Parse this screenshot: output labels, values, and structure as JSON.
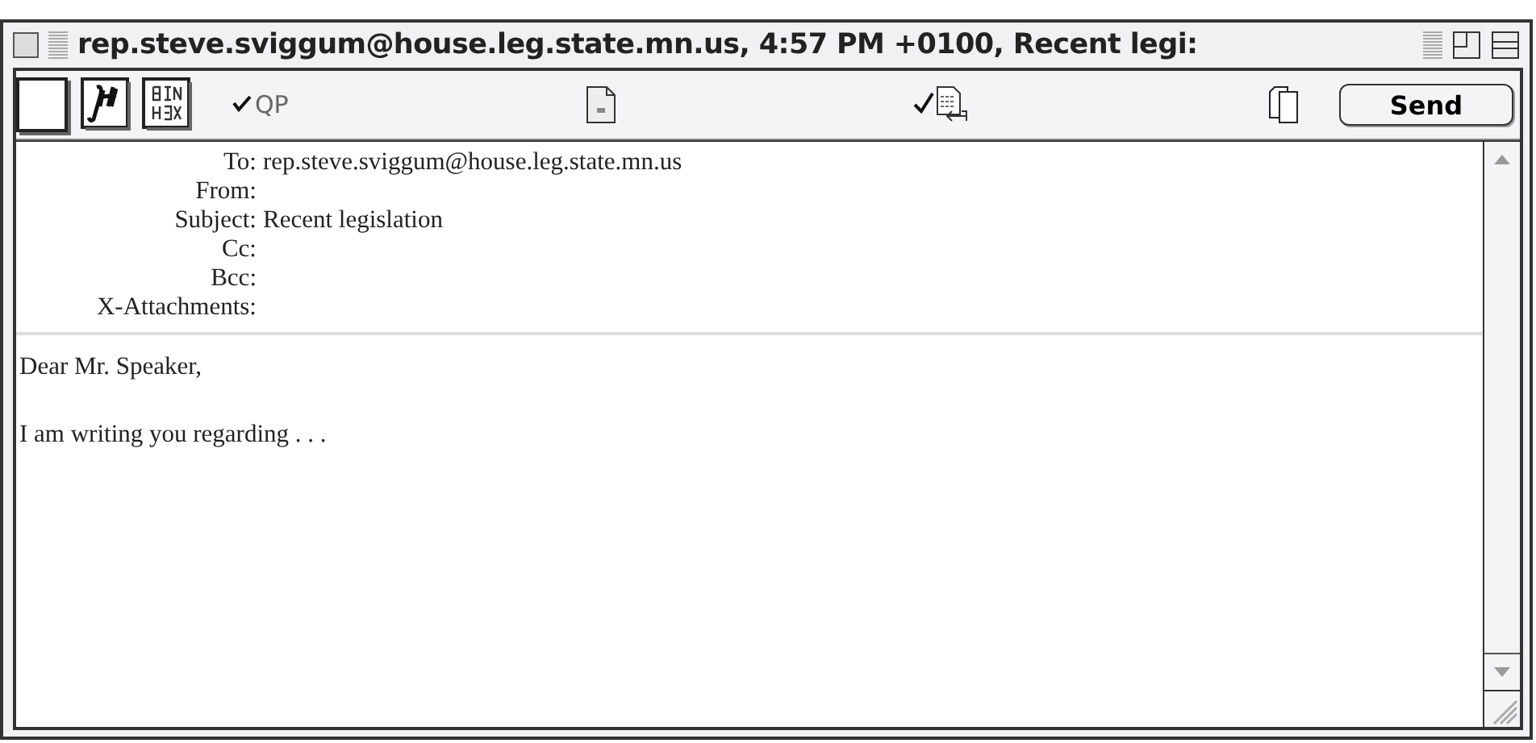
{
  "window": {
    "title": "rep.steve.sviggum@house.leg.state.mn.us, 4:57 PM +0100, Recent legi:"
  },
  "toolbar": {
    "qp": {
      "label": "QP",
      "checked": true
    },
    "document_check": {
      "checked": true
    },
    "send_button": "Send"
  },
  "headers": [
    {
      "label": "To:",
      "value": "rep.steve.sviggum@house.leg.state.mn.us"
    },
    {
      "label": "From:"
    },
    {
      "label": "Subject:",
      "value": "Recent legislation"
    },
    {
      "label": "Cc:"
    },
    {
      "label": "Bcc:"
    },
    {
      "label": "X-Attachments:"
    }
  ],
  "body": [
    "Dear Mr. Speaker,",
    "I am writing you regarding . . ."
  ]
}
